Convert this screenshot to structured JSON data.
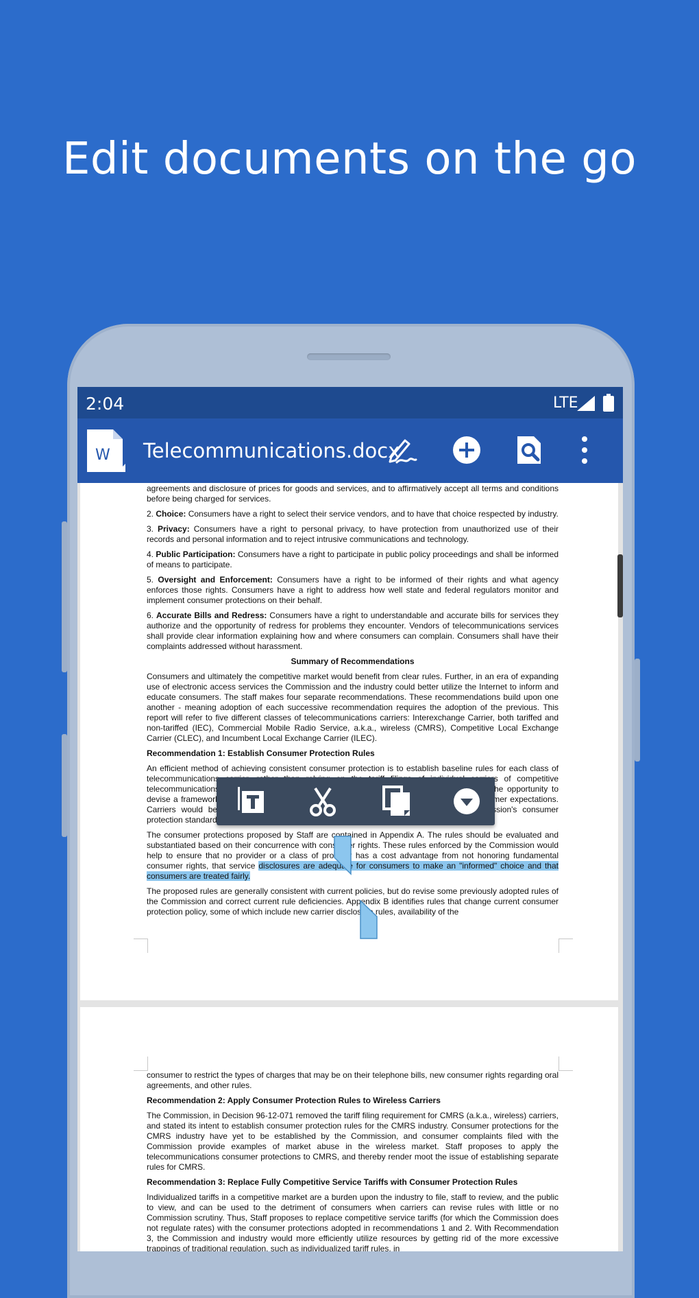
{
  "headline": "Edit documents on the go",
  "status": {
    "time": "2:04",
    "network": "LTE"
  },
  "appbar": {
    "file_name": "Telecommunications.docx"
  },
  "icons": {
    "app": "word-icon",
    "edit": "pen-icon",
    "add": "add-circle-icon",
    "find": "search-doc-icon",
    "more": "more-vert-icon",
    "select_text": "text-select-icon",
    "cut": "scissors-icon",
    "copy": "copy-icon",
    "more_menu": "dropdown-icon"
  },
  "colors": {
    "background": "#2c6ccb",
    "appbar": "#2557ad",
    "statusbar": "#1e4a8f",
    "selection": "#8cc6ee"
  },
  "page1": {
    "intro": "agreements and disclosure of prices for goods and services, and to affirmatively accept all terms and conditions before being charged for services.",
    "rights": [
      {
        "num": "2.",
        "title": "Choice:",
        "text": "Consumers have a right to select their service vendors, and to have that choice respected by industry."
      },
      {
        "num": "3.",
        "title": "Privacy:",
        "text": "Consumers have a right to personal privacy, to have protection from unauthorized use of their records and personal information and to reject intrusive communications and technology."
      },
      {
        "num": "4.",
        "title": "Public Participation:",
        "text": "Consumers have a right to participate in public policy proceedings and shall be informed of means to participate."
      },
      {
        "num": "5.",
        "title": "Oversight and Enforcement:",
        "text": "Consumers have a right to be informed of their rights and what agency enforces those rights. Consumers have a right to address how well state and federal regulators monitor and implement consumer protections on their behalf."
      },
      {
        "num": "6.",
        "title": "Accurate Bills and Redress:",
        "text": "Consumers have a right to understandable and accurate bills for services they authorize and the opportunity of redress for problems they encounter. Vendors of telecommunications services shall provide clear information explaining how and where consumers can complain. Consumers shall have their complaints addressed without harassment."
      }
    ],
    "summary_heading": "Summary of Recommendations",
    "summary_text": "Consumers and ultimately the competitive market would benefit from clear rules. Further, in an era of expanding use of electronic access services the Commission and the industry could better utilize the Internet to inform and educate consumers. The staff makes four separate recommendations. These recommendations build upon one another - meaning adoption of each successive recommendation requires the adoption of the previous. This report will refer to five different classes of telecommunications carriers: Interexchange Carrier, both tariffed and non-tariffed (IEC), Commercial Mobile Radio Service, a.k.a., wireless (CMRS), Competitive Local Exchange Carrier (CLEC), and Incumbent Local Exchange Carrier (ILEC).",
    "rec1_heading": "Recommendation 1: Establish Consumer Protection Rules",
    "rec1_text": "An efficient method of achieving consistent consumer protection is to establish baseline rules for each class of telecommunications carrier, rather than relying on the tariff filings of individual carriers of competitive telecommunications services. Staff proposes a set of minimum rules which would provide the opportunity to devise a framework of consumer protections. Baseline rules would allow for consistent consumer expectations. Carriers would be authorized to provide consumer protections that exceed the Commission's consumer protection standards.",
    "rec1_text2_plain": "The consumer protections proposed by Staff are contained in Appendix A. The rules should be evaluated and substantiated based on their concurrence with consumer rights. These rules enforced by the Commission would help to ensure that no provider or a class of provider has a cost advantage from not honoring fundamental consumer rights, that service ",
    "rec1_text2_selected": "disclosures are adequate for consumers to make an \"informed\" choice and that consumers are treated fairly.",
    "rec1_text3": "The proposed rules are generally consistent with current policies, but do revise some previously adopted rules of the Commission and correct current rule deficiencies. Appendix B identifies rules that change current consumer protection policy, some of which include new carrier disclosure rules, availability of the"
  },
  "page2": {
    "intro": "consumer to restrict the types of charges that may be on their telephone bills, new consumer rights regarding oral agreements, and other rules.",
    "rec2_heading": "Recommendation 2: Apply Consumer Protection Rules to Wireless Carriers",
    "rec2_text": "The Commission, in Decision 96-12-071 removed the tariff filing requirement for CMRS (a.k.a., wireless) carriers, and stated its intent to establish consumer protection rules for the CMRS industry. Consumer protections for the CMRS industry have yet to be established by the Commission, and consumer complaints filed with the Commission provide examples of market abuse in the wireless market. Staff proposes to apply the telecommunications consumer protections to CMRS, and thereby render moot the issue of establishing separate rules for CMRS.",
    "rec3_heading": "Recommendation 3: Replace Fully Competitive Service Tariffs with Consumer Protection Rules",
    "rec3_text": "Individualized tariffs in a competitive market are a burden upon the industry to file, staff to review, and the public to view, and can be used to the detriment of consumers when carriers can revise rules with little or no Commission scrutiny. Thus, Staff proposes to replace competitive service tariffs (for which the Commission does not regulate rates) with the consumer protections adopted in recommendations 1 and 2. With Recommendation 3, the Commission and industry would more efficiently utilize resources by getting rid of the more excessive trappings of traditional regulation, such as individualized tariff rules, in"
  }
}
